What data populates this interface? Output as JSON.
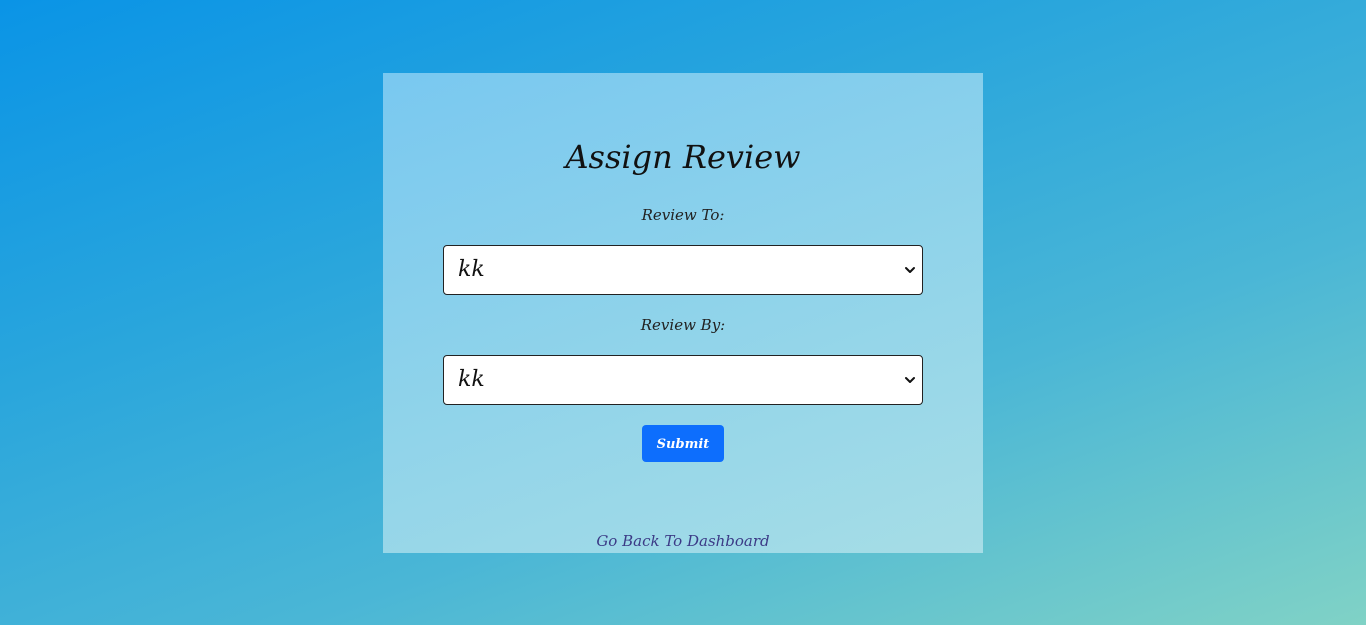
{
  "page": {
    "title": "Assign Review"
  },
  "form": {
    "review_to": {
      "label": "Review To:",
      "selected": "kk"
    },
    "review_by": {
      "label": "Review By:",
      "selected": "kk"
    },
    "submit_label": "Submit"
  },
  "footer": {
    "back_link": "Go Back To Dashboard"
  },
  "icons": {
    "select_arrow": "chevron-down-icon"
  },
  "colors": {
    "submit_bg": "#0d6efd",
    "link": "#3b3a86"
  }
}
